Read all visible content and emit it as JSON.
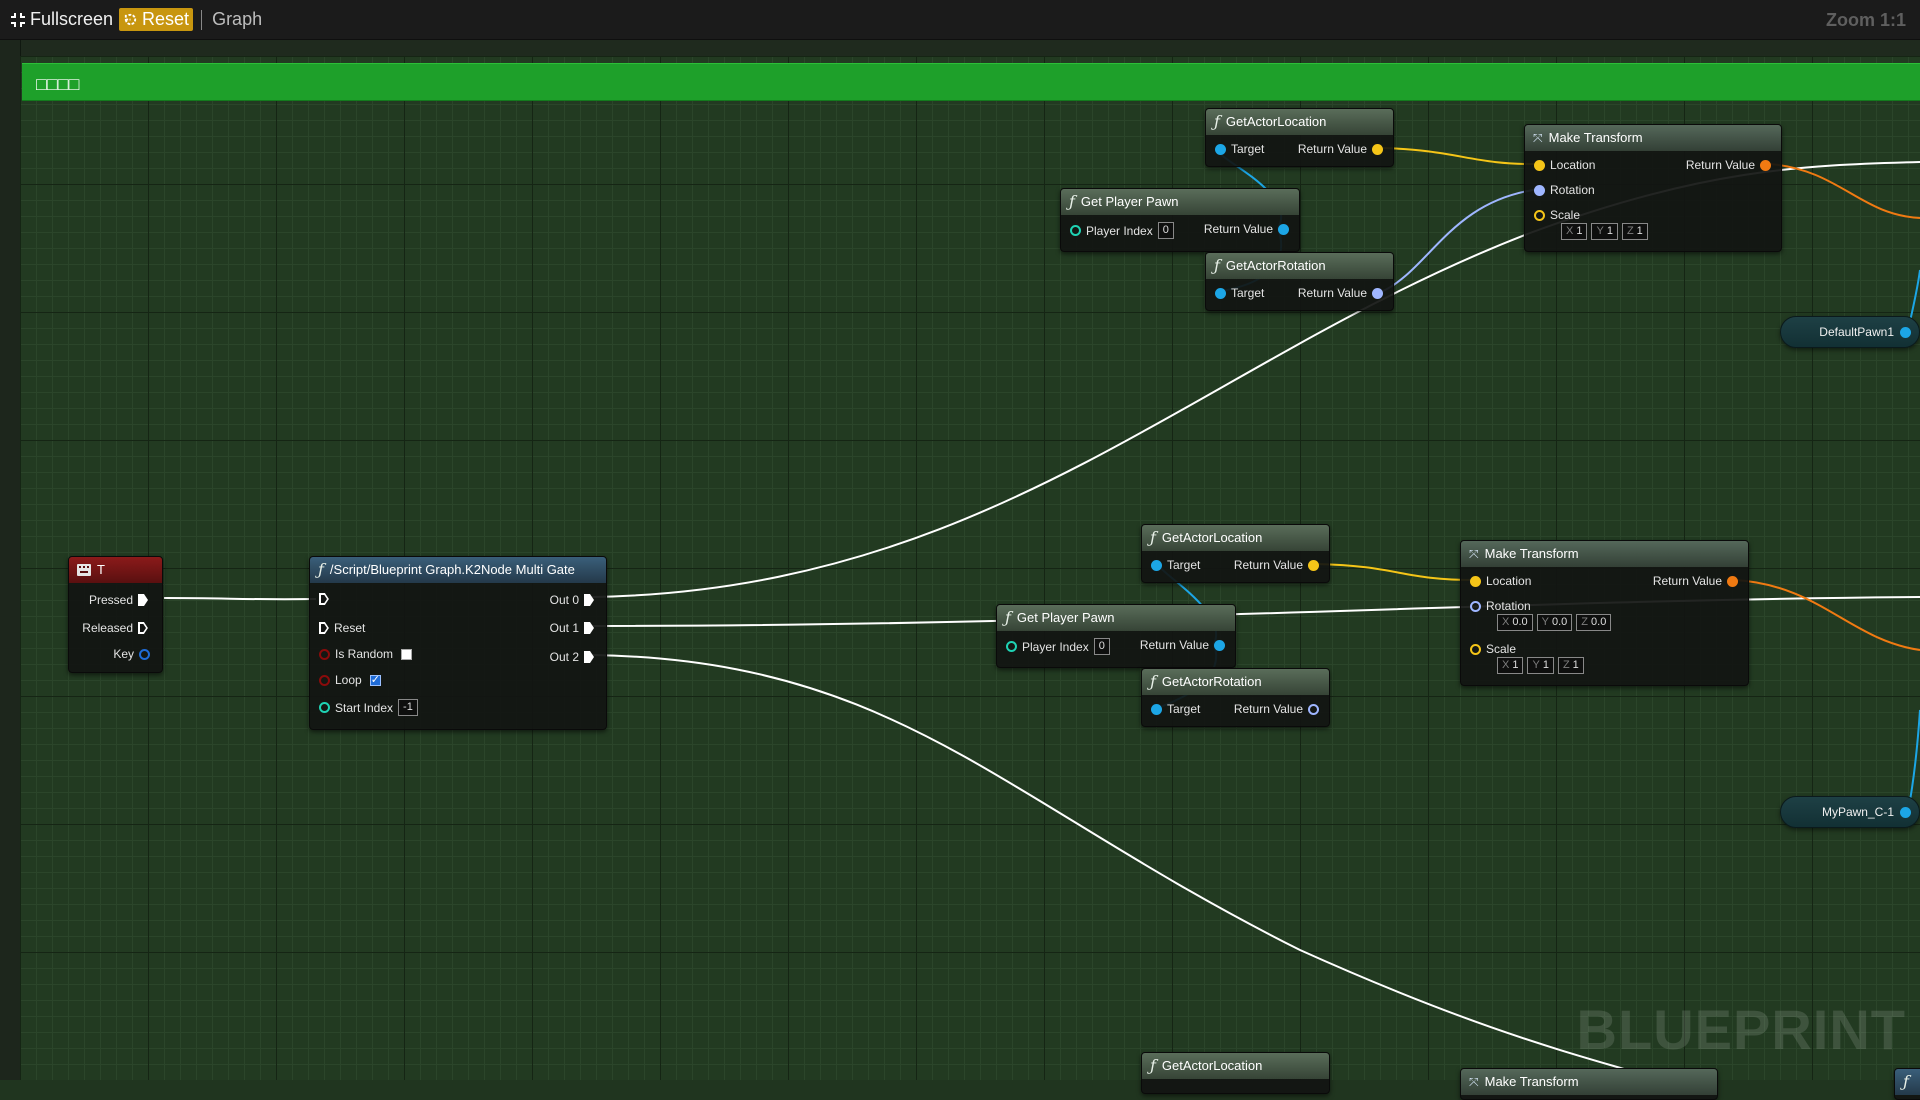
{
  "toolbar": {
    "fullscreen_label": "Fullscreen",
    "fullscreen_icon": "fullscreen-icon",
    "reset_label": "Reset",
    "reset_icon": "reset-icon",
    "graph_label": "Graph",
    "zoom_label": "Zoom 1:1"
  },
  "comment": {
    "text": "□□□□"
  },
  "nodes": {
    "event_t": {
      "title": "T",
      "pressed": "Pressed",
      "released": "Released",
      "key": "Key"
    },
    "multigate": {
      "title": "/Script/Blueprint Graph.K2Node Multi Gate",
      "reset": "Reset",
      "is_random": "Is Random",
      "is_random_checked": false,
      "loop": "Loop",
      "loop_checked": true,
      "start_index": "Start Index",
      "start_index_value": "-1",
      "out0": "Out 0",
      "out1": "Out 1",
      "out2": "Out 2"
    },
    "gal1": {
      "title": "GetActorLocation",
      "target": "Target",
      "ret": "Return Value"
    },
    "gpp1": {
      "title": "Get Player Pawn",
      "player_index": "Player Index",
      "player_index_value": "0",
      "ret": "Return Value"
    },
    "gar1": {
      "title": "GetActorRotation",
      "target": "Target",
      "ret": "Return Value"
    },
    "mt1": {
      "title": "Make Transform",
      "location": "Location",
      "rotation": "Rotation",
      "scale": "Scale",
      "ret": "Return Value",
      "scale_x": "1",
      "scale_y": "1",
      "scale_z": "1"
    },
    "gal2": {
      "title": "GetActorLocation",
      "target": "Target",
      "ret": "Return Value"
    },
    "gpp2": {
      "title": "Get Player Pawn",
      "player_index": "Player Index",
      "player_index_value": "0",
      "ret": "Return Value"
    },
    "gar2": {
      "title": "GetActorRotation",
      "target": "Target",
      "ret": "Return Value"
    },
    "mt2": {
      "title": "Make Transform",
      "location": "Location",
      "rotation": "Rotation",
      "scale": "Scale",
      "ret": "Return Value",
      "rot_x": "0.0",
      "rot_y": "0.0",
      "rot_z": "0.0",
      "scale_x": "1",
      "scale_y": "1",
      "scale_z": "1"
    },
    "gal3": {
      "title": "GetActorLocation"
    },
    "mt3": {
      "title": "Make Transform"
    },
    "var1": {
      "label": "DefaultPawn1"
    },
    "var2": {
      "label": "MyPawn_C-1"
    }
  },
  "axis_labels": {
    "x": "X",
    "y": "Y",
    "z": "Z"
  },
  "watermark": "BLUEPRINT",
  "colors": {
    "exec": "#ffffff",
    "object": "#1ca6e6",
    "vector": "#f5c518",
    "rotator": "#9fb6ff",
    "transform": "#f07a12",
    "int": "#1fd3b4",
    "bool": "#8a0b0b",
    "comment": "#1ea02a"
  }
}
